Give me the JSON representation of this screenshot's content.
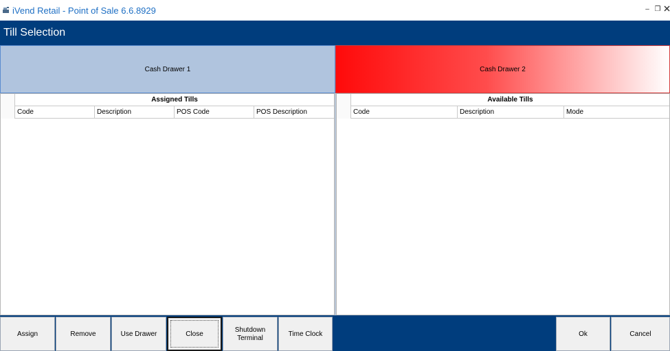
{
  "window": {
    "title": "iVend Retail - Point of Sale 6.6.8929",
    "minimize": "–",
    "restore": "❐",
    "icon": "register-icon"
  },
  "page": {
    "title": "Till Selection"
  },
  "drawers": {
    "drawer1": "Cash Drawer 1",
    "drawer2": "Cash Drawer 2"
  },
  "assigned": {
    "title": "Assigned Tills",
    "columns": [
      "Code",
      "Description",
      "POS Code",
      "POS Description"
    ]
  },
  "available": {
    "title": "Available Tills",
    "columns": [
      "Code",
      "Description",
      "Mode"
    ]
  },
  "buttons": {
    "assign": "Assign",
    "remove": "Remove",
    "use_drawer": "Use Drawer",
    "close": "Close",
    "shutdown_line1": "Shutdown",
    "shutdown_line2": "Terminal",
    "time_clock": "Time Clock",
    "ok": "Ok",
    "cancel": "Cancel"
  },
  "colors": {
    "brand_blue": "#003d7d",
    "drawer1_selected": "#b0c4de",
    "drawer2_alert": "#ff0a0a"
  }
}
